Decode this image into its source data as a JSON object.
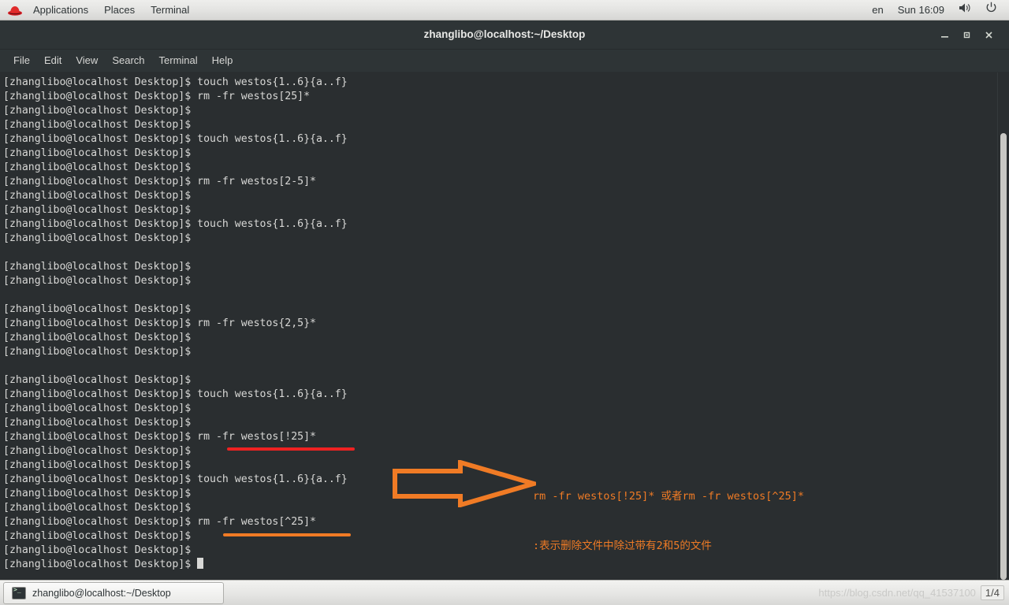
{
  "top_panel": {
    "logo": "redhat-fedora-logo",
    "items": [
      "Applications",
      "Places",
      "Terminal"
    ],
    "keyboard_layout": "en",
    "clock": "Sun 16:09",
    "volume_icon": "speaker-icon",
    "power_icon": "power-icon"
  },
  "window": {
    "title": "zhanglibo@localhost:~/Desktop",
    "minimize_label": "—",
    "maximize_label": "▫",
    "close_label": "✕"
  },
  "menubar": {
    "items": [
      "File",
      "Edit",
      "View",
      "Search",
      "Terminal",
      "Help"
    ]
  },
  "terminal": {
    "prompt": "[zhanglibo@localhost Desktop]$",
    "lines": [
      "[zhanglibo@localhost Desktop]$ touch westos{1..6}{a..f}",
      "[zhanglibo@localhost Desktop]$ rm -fr westos[25]*",
      "[zhanglibo@localhost Desktop]$",
      "[zhanglibo@localhost Desktop]$",
      "[zhanglibo@localhost Desktop]$ touch westos{1..6}{a..f}",
      "[zhanglibo@localhost Desktop]$",
      "[zhanglibo@localhost Desktop]$",
      "[zhanglibo@localhost Desktop]$ rm -fr westos[2-5]*",
      "[zhanglibo@localhost Desktop]$",
      "[zhanglibo@localhost Desktop]$",
      "[zhanglibo@localhost Desktop]$ touch westos{1..6}{a..f}",
      "[zhanglibo@localhost Desktop]$",
      "",
      "[zhanglibo@localhost Desktop]$",
      "[zhanglibo@localhost Desktop]$",
      "",
      "[zhanglibo@localhost Desktop]$",
      "[zhanglibo@localhost Desktop]$ rm -fr westos{2,5}*",
      "[zhanglibo@localhost Desktop]$",
      "[zhanglibo@localhost Desktop]$",
      "",
      "[zhanglibo@localhost Desktop]$",
      "[zhanglibo@localhost Desktop]$ touch westos{1..6}{a..f}",
      "[zhanglibo@localhost Desktop]$",
      "[zhanglibo@localhost Desktop]$",
      "[zhanglibo@localhost Desktop]$ rm -fr westos[!25]*",
      "[zhanglibo@localhost Desktop]$",
      "[zhanglibo@localhost Desktop]$",
      "[zhanglibo@localhost Desktop]$ touch westos{1..6}{a..f}",
      "[zhanglibo@localhost Desktop]$",
      "[zhanglibo@localhost Desktop]$",
      "[zhanglibo@localhost Desktop]$ rm -fr westos[^25]*",
      "[zhanglibo@localhost Desktop]$",
      "[zhanglibo@localhost Desktop]$",
      "[zhanglibo@localhost Desktop]$ "
    ],
    "cursor_line_index": 34,
    "scrollbar": {
      "thumb_top_pct": 12,
      "thumb_height_pct": 88
    }
  },
  "annotations": {
    "red_underline_color": "#ee2222",
    "orange_underline_color": "#f07b25",
    "arrow_color": "#f07b25",
    "note_line1": "rm -fr westos[!25]* 或者rm -fr westos[^25]*",
    "note_line2": ":表示删除文件中除过带有2和5的文件"
  },
  "bottom_panel": {
    "task_label": "zhanglibo@localhost:~/Desktop",
    "task_icon": "terminal-icon",
    "watermark": "https://blog.csdn.net/qq_41537100",
    "page_indicator": "1/4"
  },
  "colors": {
    "terminal_bg": "#2a2e30",
    "terminal_fg": "#d8d8d6",
    "panel_bg": "#e6e6e4",
    "accent_orange": "#f07b25",
    "accent_red": "#ee2222"
  }
}
